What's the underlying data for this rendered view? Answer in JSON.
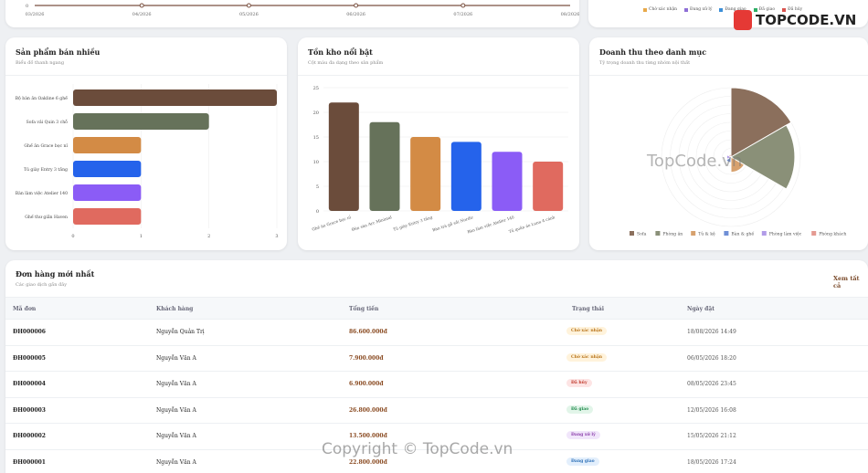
{
  "top_chart": {
    "y_tick": "0",
    "x_ticks": [
      "03/2026",
      "04/2026",
      "05/2026",
      "06/2026",
      "07/2026",
      "08/2026"
    ],
    "values": [
      0,
      0,
      0,
      0,
      0,
      0
    ]
  },
  "top_right_legend": [
    "Chờ xác nhận",
    "Đang xử lý",
    "Đang giao",
    "Đã giao",
    "Đã hủy"
  ],
  "best_sellers": {
    "title": "Sản phẩm bán nhiều",
    "subtitle": "Biểu đồ thanh ngang",
    "chart_data": {
      "type": "bar",
      "orientation": "horizontal",
      "categories": [
        "Bộ bàn ăn Oakline 6 ghế",
        "Sofa vải Quin 3 chỗ",
        "Ghế ăn Grace bọc nỉ",
        "Tủ giày Entry 3 tầng",
        "Bàn làm việc Atelier 140",
        "Ghế thư giãn Haven"
      ],
      "values": [
        3,
        2,
        1,
        1,
        1,
        1
      ],
      "colors": [
        "#6b4c3b",
        "#66725a",
        "#d38b45",
        "#2563eb",
        "#8b5cf6",
        "#e06a5f"
      ],
      "x_ticks": [
        "0",
        "1",
        "2",
        "3"
      ],
      "xlim": [
        0,
        3
      ]
    }
  },
  "stock": {
    "title": "Tồn kho nổi bật",
    "subtitle": "Cột màu đa dạng theo sản phẩm",
    "chart_data": {
      "type": "bar",
      "categories": [
        "Ghế ăn Grace bọc nỉ",
        "Đèn sàn Arc Minimal",
        "Tủ giày Entry 3 tầng",
        "Bàn trà gỗ sồi Nordic",
        "Bàn làm việc Atelier 140",
        "Tủ quần áo Luna 4 cánh"
      ],
      "values": [
        22,
        18,
        15,
        14,
        12,
        10
      ],
      "colors": [
        "#6b4c3b",
        "#66725a",
        "#d38b45",
        "#2563eb",
        "#8b5cf6",
        "#e06a5f"
      ],
      "y_ticks": [
        "0",
        "5",
        "10",
        "15",
        "20",
        "25"
      ],
      "ylim": [
        0,
        25
      ]
    }
  },
  "revenue": {
    "title": "Doanh thu theo danh mục",
    "subtitle": "Tỷ trọng doanh thu từng nhóm nội thất",
    "chart_data": {
      "type": "pie",
      "variant": "polar-area",
      "categories": [
        "Sofa",
        "Phòng ăn",
        "Tủ & kệ",
        "Bàn & ghế",
        "Phòng làm việc",
        "Phòng khách"
      ],
      "values": [
        100,
        92,
        22,
        8,
        6,
        4
      ],
      "colors": [
        "#8b6f5c",
        "#8a9078",
        "#d7a16e",
        "#6f8fd6",
        "#b29ce8",
        "#e49a92"
      ]
    }
  },
  "orders": {
    "title": "Đơn hàng mới nhất",
    "subtitle": "Các giao dịch gần đây",
    "view_all": "Xem tất cả",
    "headers": [
      "Mã đơn",
      "Khách hàng",
      "Tổng tiền",
      "Trạng thái",
      "Ngày đặt"
    ],
    "rows": [
      {
        "id": "ĐH000006",
        "customer": "Nguyễn Quản Trị",
        "total": "86.600.000đ",
        "status": "Chờ xác nhận",
        "status_key": "pending",
        "date": "18/08/2026 14:49"
      },
      {
        "id": "ĐH000005",
        "customer": "Nguyễn Văn A",
        "total": "7.900.000đ",
        "status": "Chờ xác nhận",
        "status_key": "pending",
        "date": "06/05/2026 18:20"
      },
      {
        "id": "ĐH000004",
        "customer": "Nguyễn Văn A",
        "total": "6.900.000đ",
        "status": "Đã hủy",
        "status_key": "cancelled",
        "date": "08/05/2026 23:45"
      },
      {
        "id": "ĐH000003",
        "customer": "Nguyễn Văn A",
        "total": "26.800.000đ",
        "status": "Đã giao",
        "status_key": "delivered",
        "date": "12/05/2026 16:08"
      },
      {
        "id": "ĐH000002",
        "customer": "Nguyễn Văn A",
        "total": "13.500.000đ",
        "status": "Đang xử lý",
        "status_key": "processing",
        "date": "15/05/2026 21:12"
      },
      {
        "id": "ĐH000001",
        "customer": "Nguyễn Văn A",
        "total": "22.800.000đ",
        "status": "Đang giao",
        "status_key": "shipping",
        "date": "18/05/2026 17:24"
      }
    ],
    "status_colors": {
      "pending": {
        "bg": "#fff3dc",
        "fg": "#b8741a"
      },
      "cancelled": {
        "bg": "#fde4e4",
        "fg": "#c0392b"
      },
      "delivered": {
        "bg": "#e2f5e9",
        "fg": "#1f8a4c"
      },
      "processing": {
        "bg": "#f1e6fb",
        "fg": "#8e44ad"
      },
      "shipping": {
        "bg": "#e3effc",
        "fg": "#2c6fb7"
      }
    }
  },
  "watermark": {
    "logo": "TOPCODE.VN",
    "center": "TopCode.vn",
    "bottom": "Copyright © TopCode.vn"
  }
}
